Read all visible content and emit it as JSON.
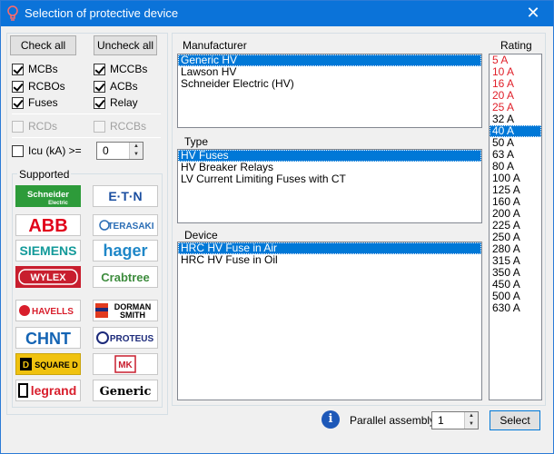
{
  "window": {
    "title": "Selection of protective device",
    "close_glyph": "✕"
  },
  "filters": {
    "check_all_label": "Check all",
    "uncheck_all_label": "Uncheck all",
    "checkboxes": [
      {
        "label": "MCBs",
        "checked": true,
        "enabled": true
      },
      {
        "label": "MCCBs",
        "checked": true,
        "enabled": true
      },
      {
        "label": "RCBOs",
        "checked": true,
        "enabled": true
      },
      {
        "label": "ACBs",
        "checked": true,
        "enabled": true
      },
      {
        "label": "Fuses",
        "checked": true,
        "enabled": true
      },
      {
        "label": "Relay",
        "checked": true,
        "enabled": true
      },
      {
        "label": "RCDs",
        "checked": false,
        "enabled": false
      },
      {
        "label": "RCCBs",
        "checked": false,
        "enabled": false
      }
    ],
    "icu_label": "Icu (kA) >=",
    "icu_checked": false,
    "icu_value": "0"
  },
  "supported": {
    "label": "Supported",
    "brands": [
      "Schneider Electric",
      "EATON",
      "ABB",
      "TERASAKI",
      "SIEMENS",
      "hager",
      "WYLEX",
      "Crabtree",
      "HAVELLS",
      "DORMAN SMITH",
      "CHINT",
      "PROTEUS",
      "SQUARE D",
      "MK",
      "legrand",
      "Generic"
    ]
  },
  "manufacturer": {
    "label": "Manufacturer",
    "items": [
      "Generic HV",
      "Lawson HV",
      "Schneider Electric (HV)"
    ],
    "selected": 0
  },
  "type": {
    "label": "Type",
    "items": [
      "HV Fuses",
      "HV Breaker Relays",
      "LV Current Limiting Fuses with CT"
    ],
    "selected": 0
  },
  "device": {
    "label": "Device",
    "items": [
      "HRC HV Fuse in Air",
      "HRC HV Fuse in Oil"
    ],
    "selected": 0
  },
  "rating": {
    "label": "Rating",
    "items": [
      "5 A",
      "10 A",
      "16 A",
      "20 A",
      "25 A",
      "32 A",
      "40 A",
      "50 A",
      "63 A",
      "80 A",
      "100 A",
      "125 A",
      "160 A",
      "200 A",
      "225 A",
      "250 A",
      "280 A",
      "315 A",
      "350 A",
      "450 A",
      "500 A",
      "630 A"
    ],
    "red_count": 5,
    "selected": 6,
    "red_color": "#e0202a"
  },
  "footer": {
    "parallel_label": "Parallel assembly",
    "parallel_value": "1",
    "select_label": "Select"
  },
  "colors": {
    "title_bar": "#0b73d9",
    "selection": "#0078d7",
    "info_icon": "#1d58b8"
  }
}
